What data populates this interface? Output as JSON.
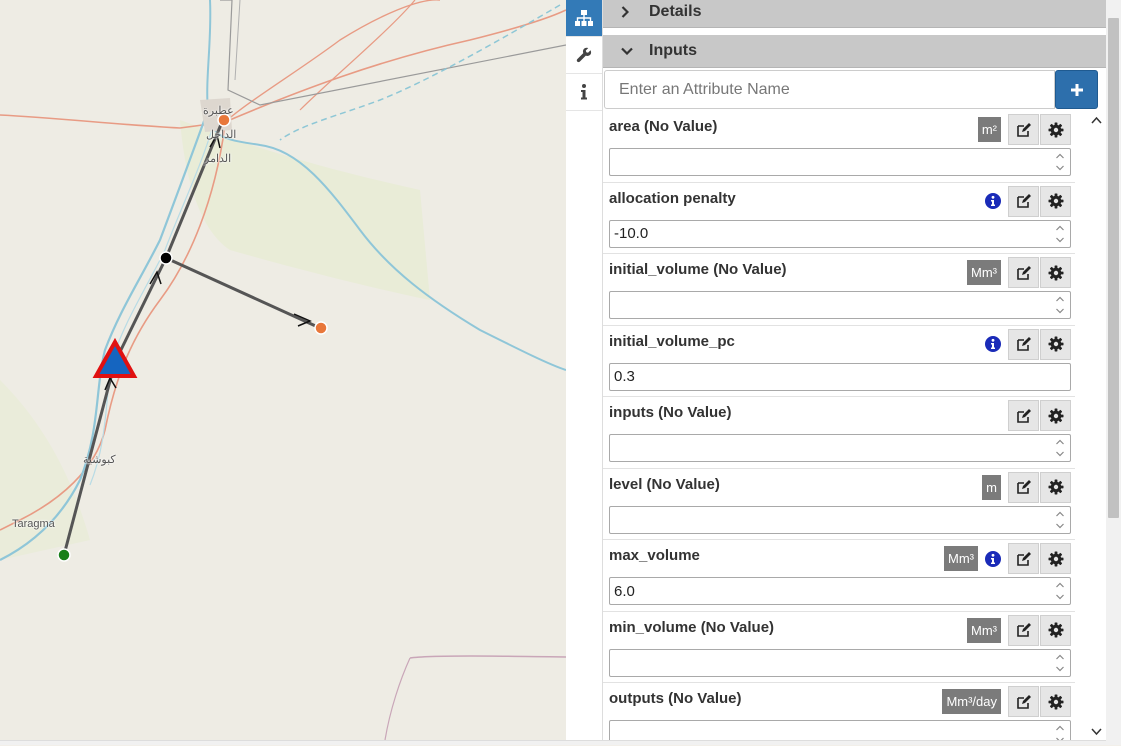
{
  "map": {
    "labels": {
      "town_top_ar": "عطبرة",
      "town_top_ar2": "الداخل",
      "town_top_ar3": "الدامر",
      "town_mid_ar": "كبوشية",
      "town_bottom": "Taragma"
    },
    "colors": {
      "link": "#555555",
      "node_junction": "#000000",
      "node_output": "#e8773a",
      "node_source": "#1a7f1a",
      "reservoir_fill": "#1565c0",
      "reservoir_border": "#e01010",
      "river": "#8fc6d8"
    }
  },
  "tabs": [
    {
      "name": "network-tab",
      "icon": "sitemap-icon",
      "active": true
    },
    {
      "name": "tools-tab",
      "icon": "wrench-icon",
      "active": false
    },
    {
      "name": "info-tab",
      "icon": "info-icon",
      "active": false
    }
  ],
  "panel": {
    "details_label": "Details",
    "inputs_label": "Inputs",
    "attribute_placeholder": "Enter an Attribute Name",
    "add_button_icon": "plus-icon"
  },
  "attributes": [
    {
      "name": "area (No Value)",
      "unit": "m²",
      "info": false,
      "value": "",
      "spinner": true
    },
    {
      "name": "allocation penalty",
      "unit": "",
      "info": true,
      "value": "-10.0",
      "spinner": true
    },
    {
      "name": "initial_volume (No Value)",
      "unit": "Mm³",
      "info": false,
      "value": "",
      "spinner": true
    },
    {
      "name": "initial_volume_pc",
      "unit": "",
      "info": true,
      "value": "0.3",
      "spinner": false
    },
    {
      "name": "inputs (No Value)",
      "unit": "",
      "info": false,
      "value": "",
      "spinner": true
    },
    {
      "name": "level (No Value)",
      "unit": "m",
      "info": false,
      "value": "",
      "spinner": true
    },
    {
      "name": "max_volume",
      "unit": "Mm³",
      "info": true,
      "value": "6.0",
      "spinner": true
    },
    {
      "name": "min_volume (No Value)",
      "unit": "Mm³",
      "info": false,
      "value": "",
      "spinner": true
    },
    {
      "name": "outputs (No Value)",
      "unit": "Mm³/day",
      "info": false,
      "value": "",
      "spinner": true
    }
  ]
}
